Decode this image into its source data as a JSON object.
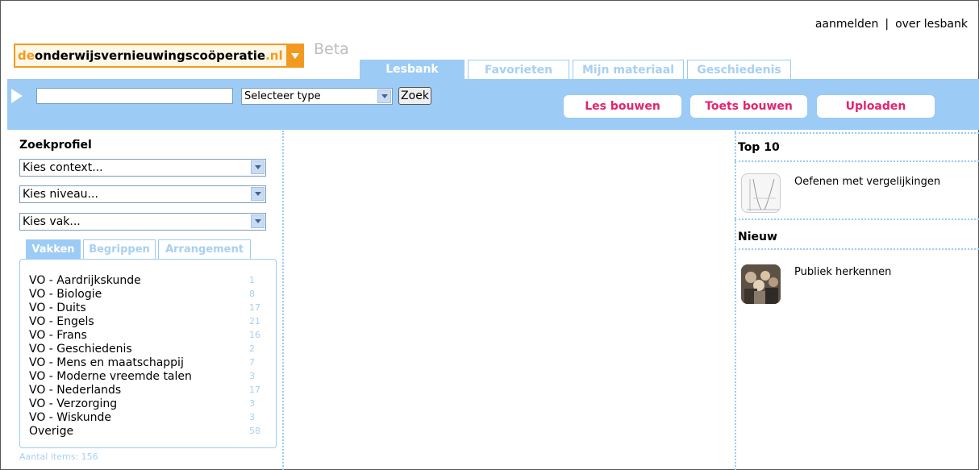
{
  "header": {
    "login_link": "aanmelden",
    "separator": "|",
    "about_link": "over lesbank",
    "logo": {
      "prefix": "de",
      "name": "onderwijsvernieuwingscoöperatie",
      "suffix": ".nl"
    },
    "beta": "Beta"
  },
  "tabs": [
    {
      "label": "Lesbank",
      "active": true
    },
    {
      "label": "Favorieten",
      "active": false
    },
    {
      "label": "Mijn materiaal",
      "active": false
    },
    {
      "label": "Geschiedenis",
      "active": false
    }
  ],
  "search": {
    "value": "",
    "type_select": "Selecteer type",
    "button": "Zoek"
  },
  "actions": {
    "build_lesson": "Les bouwen",
    "build_test": "Toets bouwen",
    "upload": "Uploaden"
  },
  "profile": {
    "title": "Zoekprofiel",
    "context": "Kies context...",
    "level": "Kies niveau...",
    "subject": "Kies vak...",
    "tabs": [
      {
        "label": "Vakken",
        "active": true
      },
      {
        "label": "Begrippen",
        "active": false
      },
      {
        "label": "Arrangement",
        "active": false
      }
    ],
    "subjects": [
      {
        "name": "VO - Aardrijkskunde",
        "count": "1"
      },
      {
        "name": "VO - Biologie",
        "count": "8"
      },
      {
        "name": "VO - Duits",
        "count": "17"
      },
      {
        "name": "VO - Engels",
        "count": "21"
      },
      {
        "name": "VO - Frans",
        "count": "16"
      },
      {
        "name": "VO - Geschiedenis",
        "count": "2"
      },
      {
        "name": "VO - Mens en maatschappij",
        "count": "7"
      },
      {
        "name": "VO - Moderne vreemde talen",
        "count": "3"
      },
      {
        "name": "VO - Nederlands",
        "count": "17"
      },
      {
        "name": "VO - Verzorging",
        "count": "3"
      },
      {
        "name": "VO - Wiskunde",
        "count": "3"
      },
      {
        "name": "Overige",
        "count": "58"
      }
    ],
    "total": "Aantal items: 156"
  },
  "sidebar": {
    "top10_title": "Top 10",
    "top10_items": [
      {
        "title": "Oefenen met vergelijkingen",
        "thumb": "graph-thumbnail"
      }
    ],
    "new_title": "Nieuw",
    "new_items": [
      {
        "title": "Publiek herkennen",
        "thumb": "crowd-photo-thumbnail"
      }
    ]
  },
  "colors": {
    "accent_blue": "#9ccbf5",
    "pink": "#e3246f",
    "orange": "#f29a1f"
  }
}
